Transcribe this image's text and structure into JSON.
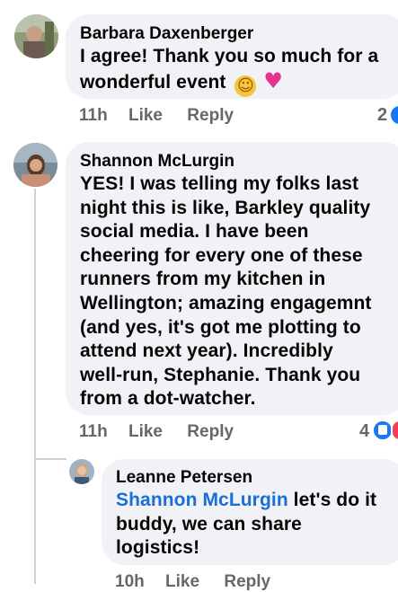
{
  "comments": [
    {
      "author": "Barbara Daxenberger",
      "text": "I agree! Thank you so much for a wonderful event",
      "emojis": "☺",
      "heart": "♥",
      "time": "11h",
      "like_label": "Like",
      "reply_label": "Reply",
      "reaction_count": "2",
      "reaction_color": "#1877f2"
    },
    {
      "author": "Shannon McLurgin",
      "text_lines": [
        "YES! I was telling my folks last",
        "night this is like, Barkley quality",
        "social media. I have been",
        "cheering for every one of these",
        "runners from my kitchen in",
        "Wellington; amazing engagemnt",
        "(and yes, it's got me plotting to",
        "attend next year). Incredibly",
        "well-run, Stephanie. Thank you",
        "from a dot-watcher."
      ],
      "time": "11h",
      "like_label": "Like",
      "reply_label": "Reply",
      "reaction_count": "4"
    }
  ],
  "reply": {
    "author": "Leanne Petersen",
    "mention": "Shannon McLurgin",
    "text_line1": " let's do it",
    "text_line2": "buddy, we can share",
    "text_line3": "logistics!",
    "time": "10h",
    "like_label": "Like",
    "reply_label": "Reply"
  },
  "colors": {
    "bubble": "#f0f2f5",
    "meta_text": "#65676b",
    "mention": "#1a6ed8",
    "like_reaction": "#1877f2",
    "heart": "#e8308f"
  }
}
